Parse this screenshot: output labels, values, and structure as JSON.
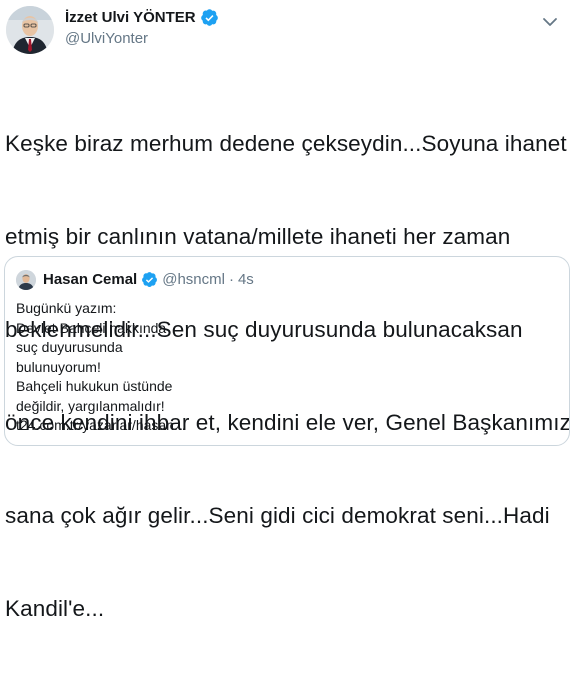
{
  "author": {
    "name": "İzzet Ulvi YÖNTER",
    "handle": "@UlviYonter"
  },
  "tweet": {
    "lines": [
      "Keşke biraz merhum dedene çekseydin...Soyuna ihanet",
      "etmiş bir canlının vatana/millete ihaneti her zaman",
      "beklenmelidir...Sen suç duyurusunda bulunacaksan",
      "önce kendini ihbar et, kendini ele ver, Genel Başkanımız",
      "sana çok ağır gelir...Seni gidi cici demokrat seni...Hadi",
      "Kandil'e..."
    ]
  },
  "quote": {
    "name": "Hasan Cemal",
    "handle": "@hsncml",
    "separator": "·",
    "time": "4s",
    "lines": [
      "Bugünkü yazım:",
      "Devlet Bahçeli hakkında",
      "suç duyurusunda",
      "bulunuyorum!",
      "Bahçeli hukukun üstünde",
      "değildir, yargılanmalıdır!",
      "t24.com.tr/yazarlar/hasan..."
    ]
  },
  "colors": {
    "verified": "#1da1f2",
    "secondary_text": "#657786",
    "border": "#ccd6dd"
  },
  "icons": {
    "verified": "verified-badge-icon",
    "menu": "chevron-down-icon"
  }
}
